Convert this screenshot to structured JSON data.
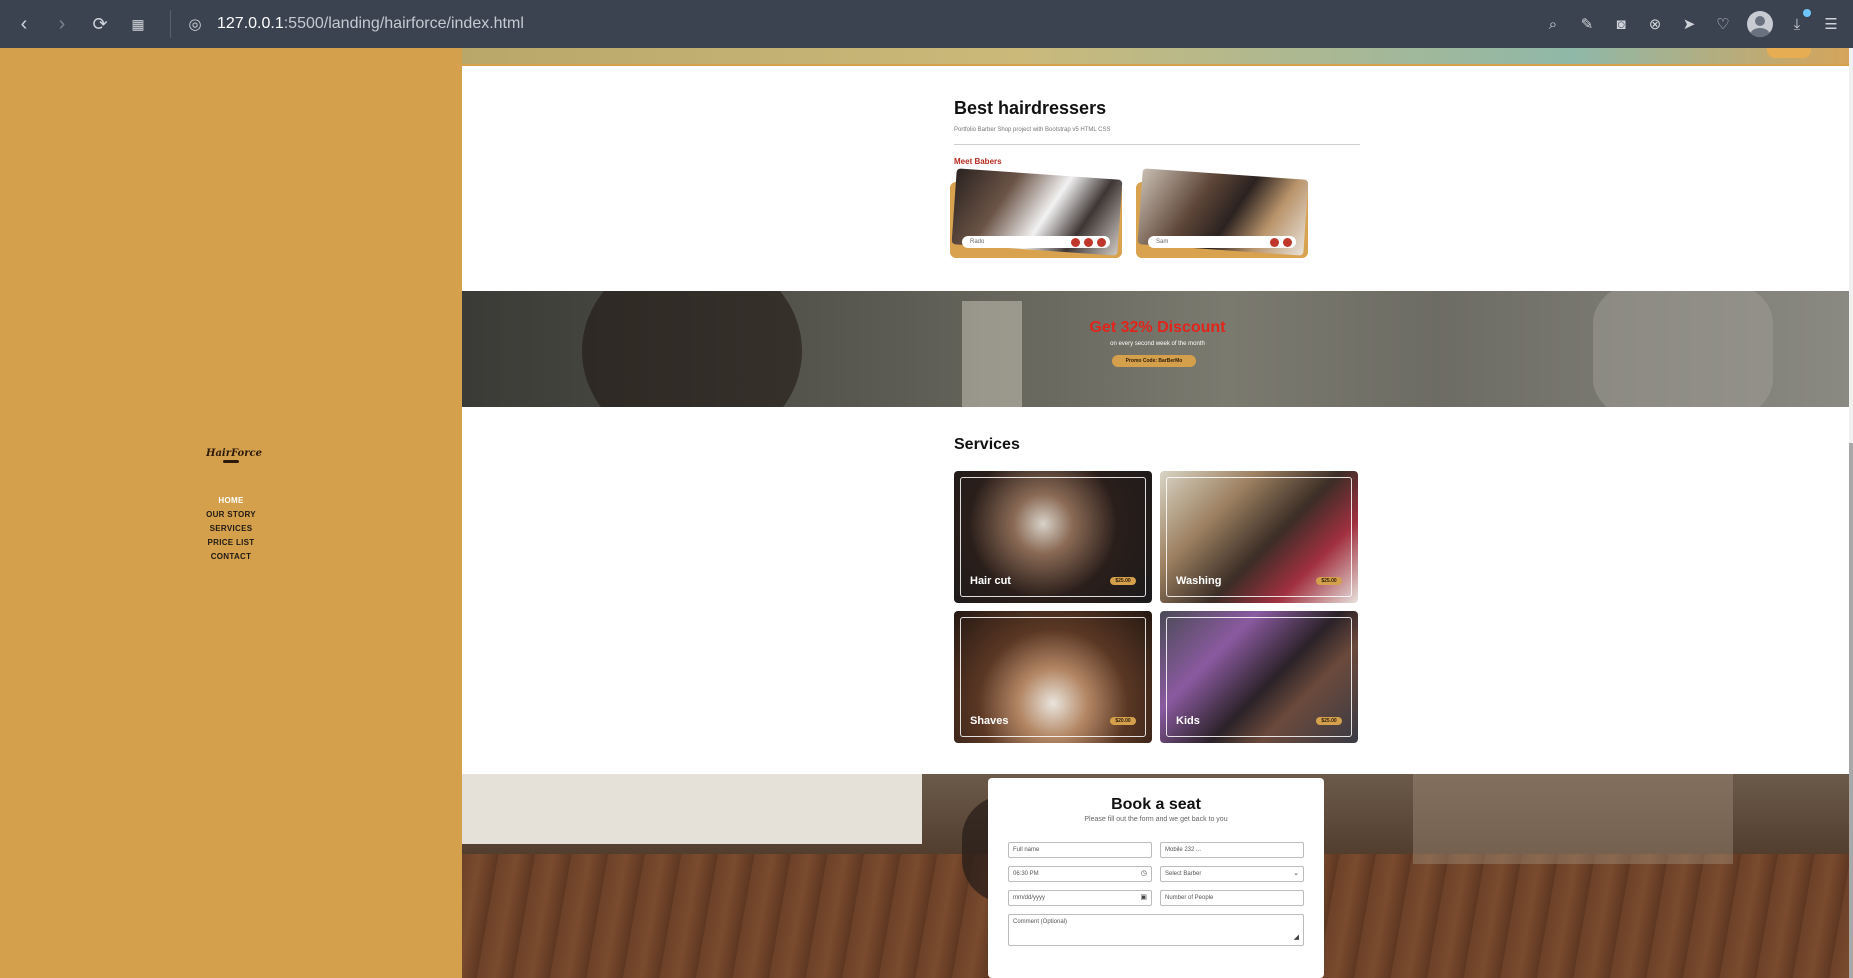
{
  "browser": {
    "url_host": "127.0.0.1",
    "url_path": ":5500/landing/hairforce/index.html"
  },
  "sidebar": {
    "logo_text": "HairForce",
    "nav": [
      {
        "label": "HOME"
      },
      {
        "label": "OUR STORY"
      },
      {
        "label": "SERVICES"
      },
      {
        "label": "PRICE LIST"
      },
      {
        "label": "CONTACT"
      }
    ]
  },
  "hairdressers": {
    "title": "Best hairdressers",
    "subtitle": "Portfolio Barber Shop project with Bootstrap v5 HTML CSS",
    "meet_label": "Meet Babers",
    "barbers": [
      {
        "name": "Rado"
      },
      {
        "name": "Sam"
      }
    ]
  },
  "discount": {
    "headline": "Get 32% Discount",
    "subline": "on every second week of the month",
    "promo": "Promo Code: BarBerMo"
  },
  "services": {
    "title": "Services",
    "items": [
      {
        "label": "Hair cut",
        "price": "$25.00"
      },
      {
        "label": "Washing",
        "price": "$25.00"
      },
      {
        "label": "Shaves",
        "price": "$20.00"
      },
      {
        "label": "Kids",
        "price": "$25.00"
      }
    ]
  },
  "booking": {
    "title": "Book a seat",
    "subtitle": "Please fill out the form and we get back to you",
    "fields": {
      "full_name": "Full name",
      "mobile": "Mobile 232 ...",
      "time": "06:30 PM",
      "barber": "Select Barber",
      "date": "mm/dd/yyyy",
      "people": "Number of People",
      "comment": "Comment (Optional)"
    }
  }
}
